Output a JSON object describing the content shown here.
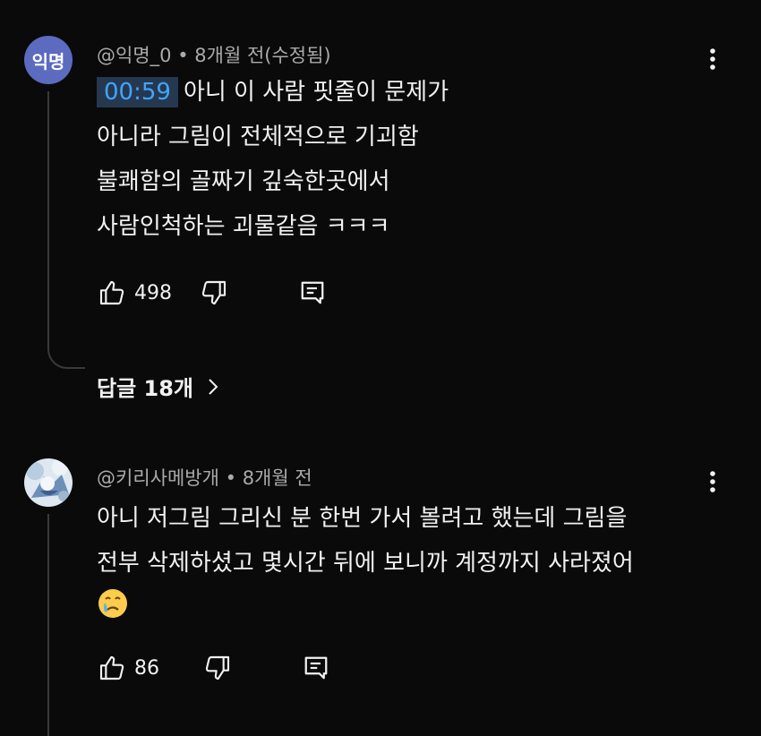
{
  "comments": [
    {
      "avatar_text": "익명",
      "author": "@익명_0",
      "separator": "•",
      "time": "8개월 전(수정됨)",
      "timestamp_link": "00:59",
      "lines": [
        "아니 이 사람 핏줄이 문제가",
        "아니라 그림이 전체적으로 기괴함",
        "불쾌함의 골짜기 깊숙한곳에서",
        "사람인척하는 괴물같음 ㅋㅋㅋ"
      ],
      "likes": "498",
      "replies_label": "답글 18개"
    },
    {
      "author": "@키리사메방개",
      "separator": "•",
      "time": "8개월 전",
      "lines": [
        "아니 저그림 그리신 분 한번 가서 볼려고 했는데 그림을",
        "전부 삭제하셨고 몇시간 뒤에 보니까 계정까지 사라졌어"
      ],
      "emoji": "crying-face",
      "likes": "86"
    }
  ],
  "icons": {
    "like": "thumbs-up-icon",
    "dislike": "thumbs-down-icon",
    "reply": "reply-icon",
    "more": "more-vert-icon",
    "chevron": "chevron-right-icon"
  },
  "colors": {
    "background": "#0a0a0a",
    "text": "#f1f1f1",
    "meta": "#aaaaaa",
    "timestamp_link": "#3ea6ff",
    "avatar": "#5c6bc0"
  }
}
